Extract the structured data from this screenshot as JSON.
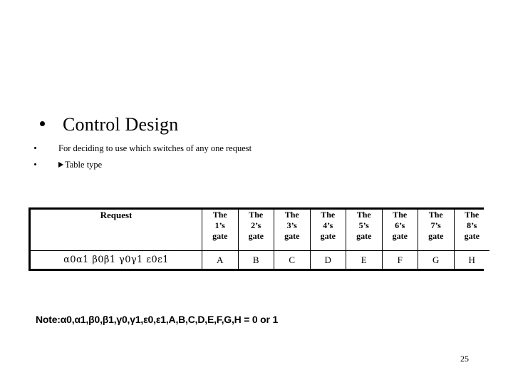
{
  "slide": {
    "title": "Control Design",
    "title_bullet_icon": "bullet-dot-icon",
    "bullets": [
      {
        "text": "For deciding to use which switches of any one request",
        "marker_icon": "bullet-dot-icon"
      },
      {
        "text": "Table type",
        "marker_icon": "triangle-right-icon",
        "lead_icon": "triangle-right-icon"
      }
    ],
    "note": "Note:α0,α1,β0,β1,γ0,γ1,ε0,ε1,A,B,C,D,E,F,G,H = 0 or 1",
    "page_number": "25"
  },
  "table": {
    "headers": [
      "Request",
      "The 1’s gate",
      "The 2’s gate",
      "The 3’s gate",
      "The 4’s gate",
      "The 5’s gate",
      "The 6’s gate",
      "The 7’s gate",
      "The 8’s gate"
    ],
    "header_parts": [
      {
        "l1": "The",
        "l2": "1’s",
        "l3": "gate"
      },
      {
        "l1": "The",
        "l2": "2’s",
        "l3": "gate"
      },
      {
        "l1": "The",
        "l2": "3’s",
        "l3": "gate"
      },
      {
        "l1": "The",
        "l2": "4’s",
        "l3": "gate"
      },
      {
        "l1": "The",
        "l2": "5’s",
        "l3": "gate"
      },
      {
        "l1": "The",
        "l2": "6’s",
        "l3": "gate"
      },
      {
        "l1": "The",
        "l2": "7’s",
        "l3": "gate"
      },
      {
        "l1": "The",
        "l2": "8’s",
        "l3": "gate"
      }
    ],
    "rows": [
      {
        "request": "α0α1  β0β1  γ0γ1  ε0ε1",
        "gates": [
          "A",
          "B",
          "C",
          "D",
          "E",
          "F",
          "G",
          "H"
        ]
      }
    ]
  },
  "colors": {
    "background": "#ffffff",
    "text": "#000000",
    "table_border": "#000000"
  }
}
